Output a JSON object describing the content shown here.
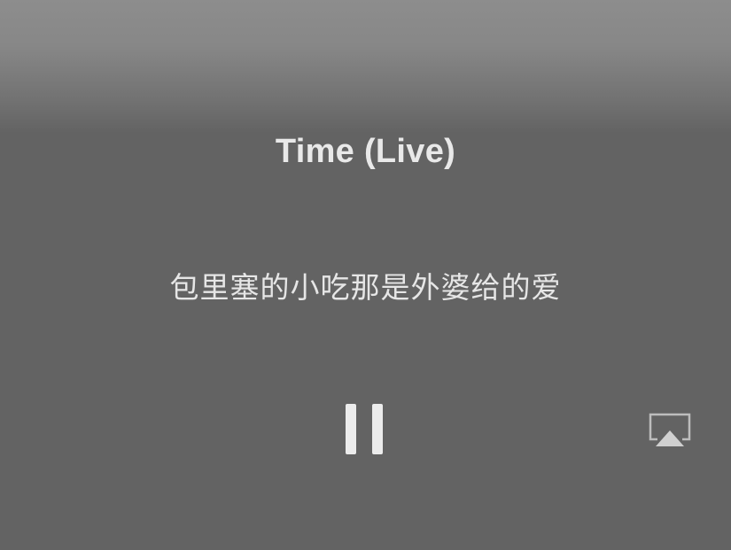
{
  "now_playing": {
    "title": "Time (Live)",
    "lyric": "包里塞的小吃那是外婆给的爱"
  },
  "controls": {
    "playback_state": "playing",
    "pause_icon": "pause-icon",
    "airplay_icon": "airplay-icon"
  },
  "colors": {
    "background": "#636363",
    "header_gradient_top": "#8d8d8d",
    "text": "#e9e9e9",
    "icon": "#ececec"
  }
}
